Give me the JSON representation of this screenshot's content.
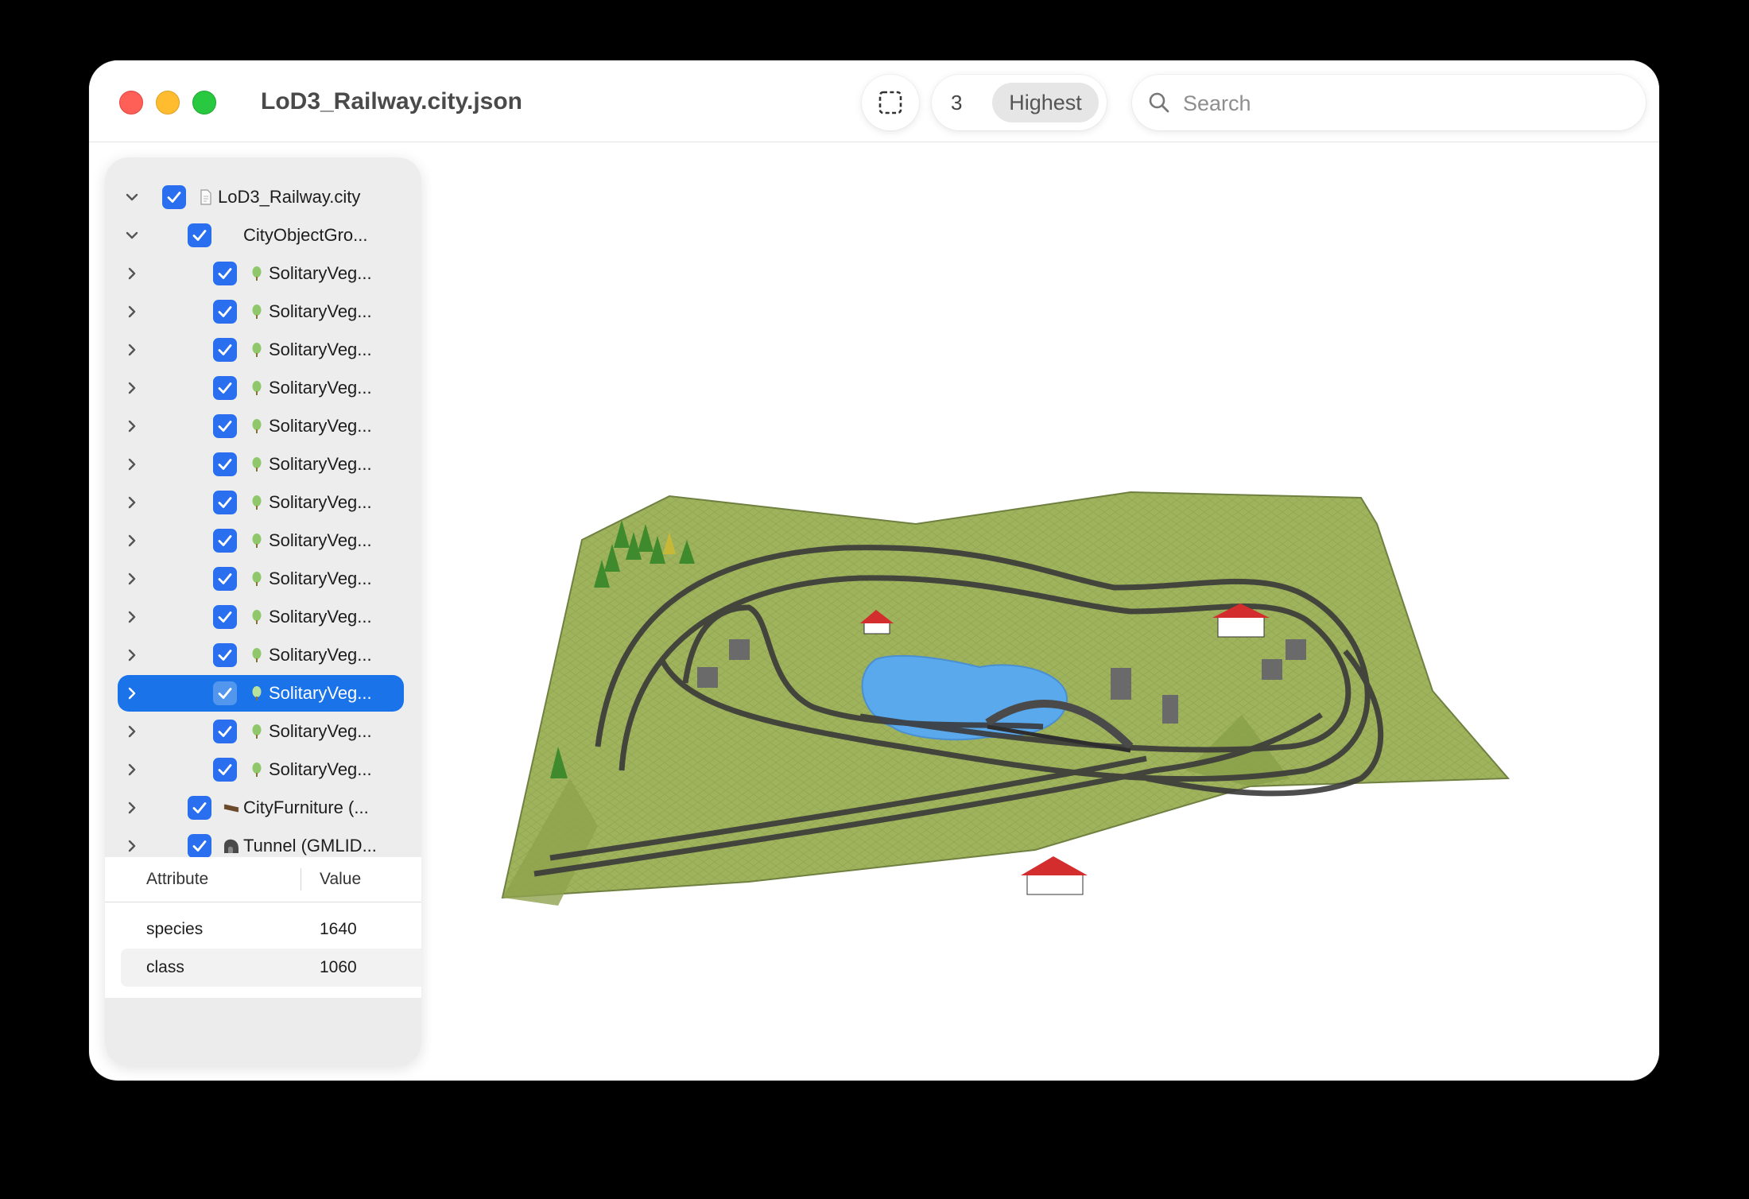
{
  "window": {
    "title": "LoD3_Railway.city.json"
  },
  "toolbar": {
    "selection_icon": "dashed-square-icon",
    "lod_value": "3",
    "lod_mode": "Highest",
    "search_placeholder": "Search",
    "search_value": ""
  },
  "tree": {
    "items": [
      {
        "label": "LoD3_Railway.city",
        "icon": "document-icon",
        "expanded": true,
        "checked": true
      },
      {
        "label": "CityObjectGro...",
        "icon": "none",
        "expanded": true,
        "checked": true
      },
      {
        "label": "SolitaryVeg...",
        "icon": "tree-icon",
        "expanded": false,
        "checked": true
      },
      {
        "label": "SolitaryVeg...",
        "icon": "tree-icon",
        "expanded": false,
        "checked": true
      },
      {
        "label": "SolitaryVeg...",
        "icon": "tree-icon",
        "expanded": false,
        "checked": true
      },
      {
        "label": "SolitaryVeg...",
        "icon": "tree-icon",
        "expanded": false,
        "checked": true
      },
      {
        "label": "SolitaryVeg...",
        "icon": "tree-icon",
        "expanded": false,
        "checked": true
      },
      {
        "label": "SolitaryVeg...",
        "icon": "tree-icon",
        "expanded": false,
        "checked": true
      },
      {
        "label": "SolitaryVeg...",
        "icon": "tree-icon",
        "expanded": false,
        "checked": true
      },
      {
        "label": "SolitaryVeg...",
        "icon": "tree-icon",
        "expanded": false,
        "checked": true
      },
      {
        "label": "SolitaryVeg...",
        "icon": "tree-icon",
        "expanded": false,
        "checked": true
      },
      {
        "label": "SolitaryVeg...",
        "icon": "tree-icon",
        "expanded": false,
        "checked": true
      },
      {
        "label": "SolitaryVeg...",
        "icon": "tree-icon",
        "expanded": false,
        "checked": true
      },
      {
        "label": "SolitaryVeg...",
        "icon": "tree-icon",
        "expanded": false,
        "checked": true,
        "selected": true
      },
      {
        "label": "SolitaryVeg...",
        "icon": "tree-icon",
        "expanded": false,
        "checked": true
      },
      {
        "label": "SolitaryVeg...",
        "icon": "tree-icon",
        "expanded": false,
        "checked": true
      },
      {
        "label": "CityFurniture (...",
        "icon": "bench-icon",
        "expanded": false,
        "checked": true
      },
      {
        "label": "Tunnel (GMLID...",
        "icon": "tunnel-icon",
        "expanded": false,
        "checked": true
      }
    ]
  },
  "attributes": {
    "header_attribute": "Attribute",
    "header_value": "Value",
    "rows": [
      {
        "name": "species",
        "value": "1640"
      },
      {
        "name": "class",
        "value": "1060"
      }
    ]
  },
  "colors": {
    "accent": "#1a73e8",
    "checkbox": "#2a6ff0",
    "terrain": "#9aae58",
    "water": "#5aa9ec",
    "roof": "#d42d2d"
  }
}
